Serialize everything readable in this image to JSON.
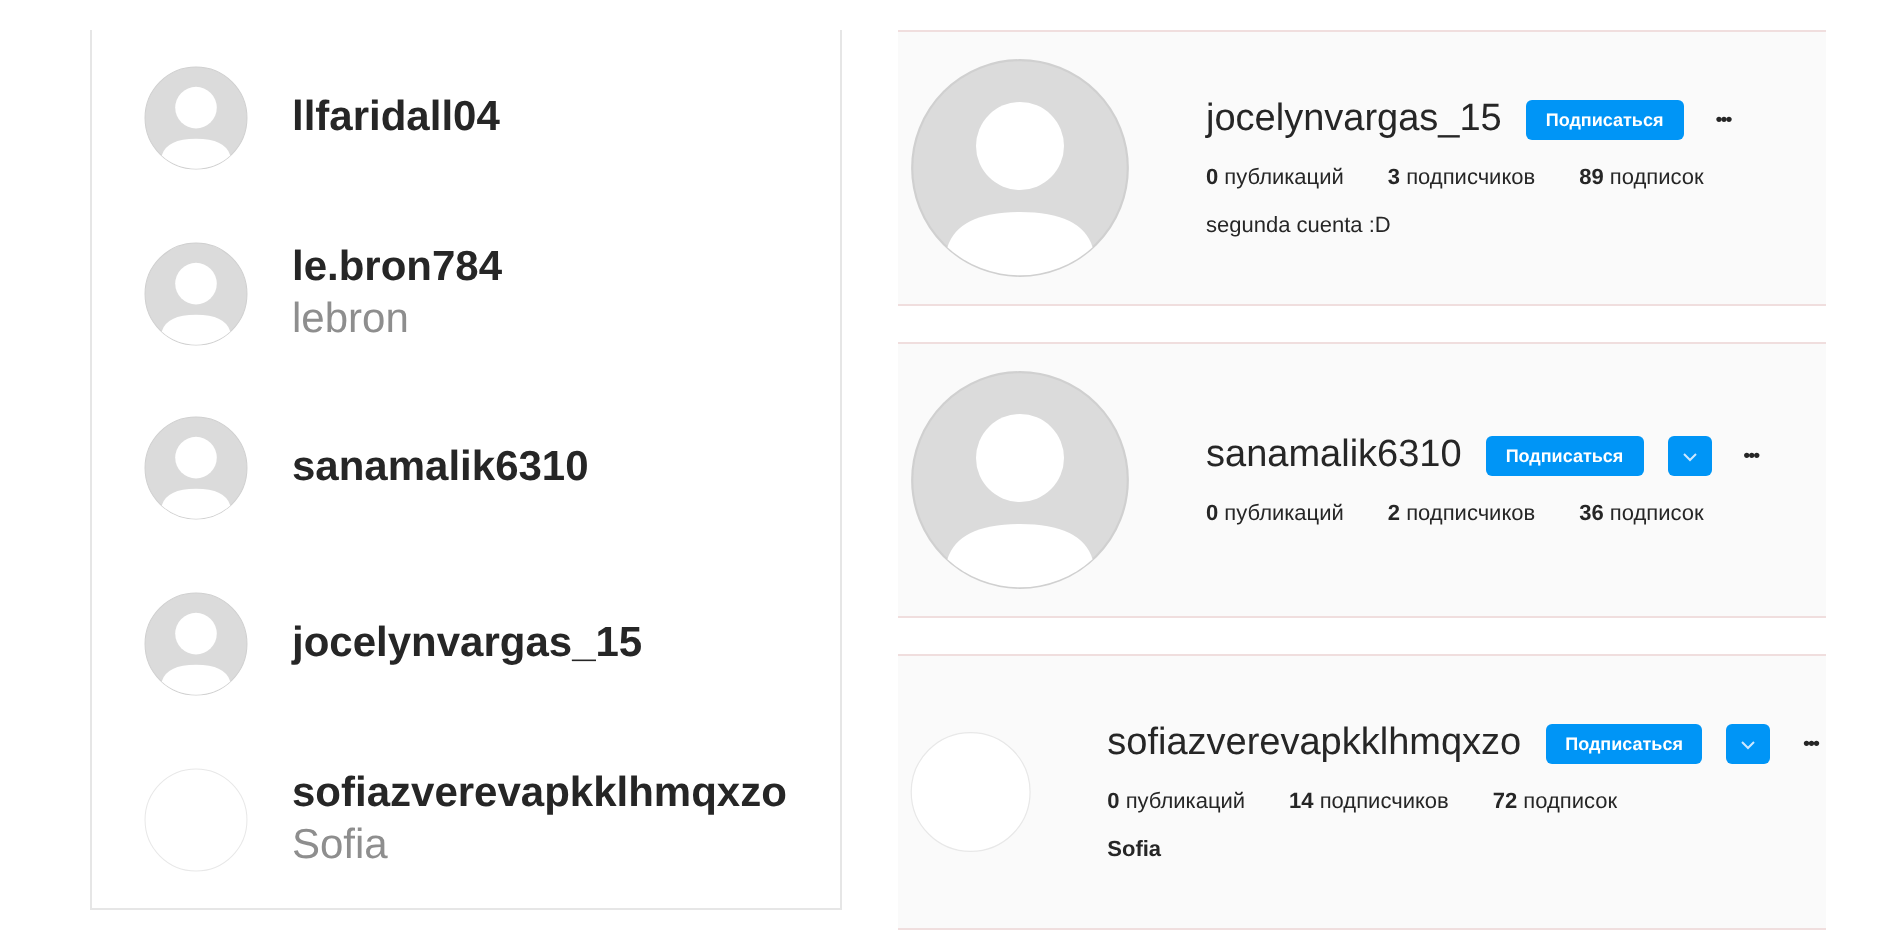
{
  "accounts": [
    {
      "username": "llfaridall04",
      "default_avatar": true
    },
    {
      "username": "le.bron784",
      "full_name": "lebron",
      "default_avatar": true
    },
    {
      "username": "sanamalik6310",
      "default_avatar": true
    },
    {
      "username": "jocelynvargas_15",
      "default_avatar": true
    },
    {
      "username": "sofiazverevapkklhmqxzo",
      "full_name": "Sofia",
      "default_avatar": false
    }
  ],
  "profiles": [
    {
      "username": "jocelynvargas_15",
      "default_avatar": true,
      "follow": "Подписаться",
      "dropdown": false,
      "more": "•••",
      "stats": [
        "**0** публикаций",
        "**3** подписчиков",
        "**89** подписок"
      ],
      "bio": "segunda cuenta :D",
      "bio_bold": false
    },
    {
      "username": "sanamalik6310",
      "default_avatar": true,
      "follow": "Подписаться",
      "dropdown": true,
      "more": "•••",
      "stats": [
        "**0** публикаций",
        "**2** подписчиков",
        "**36** подписок"
      ]
    },
    {
      "username": "sofiazverevapkklhmqxzo",
      "default_avatar": false,
      "follow": "Подписаться",
      "dropdown": true,
      "more": "•••",
      "stats": [
        "**0** публикаций",
        "**14** подписчиков",
        "**72** подписок"
      ],
      "bio": "Sofia",
      "bio_bold": true
    }
  ]
}
